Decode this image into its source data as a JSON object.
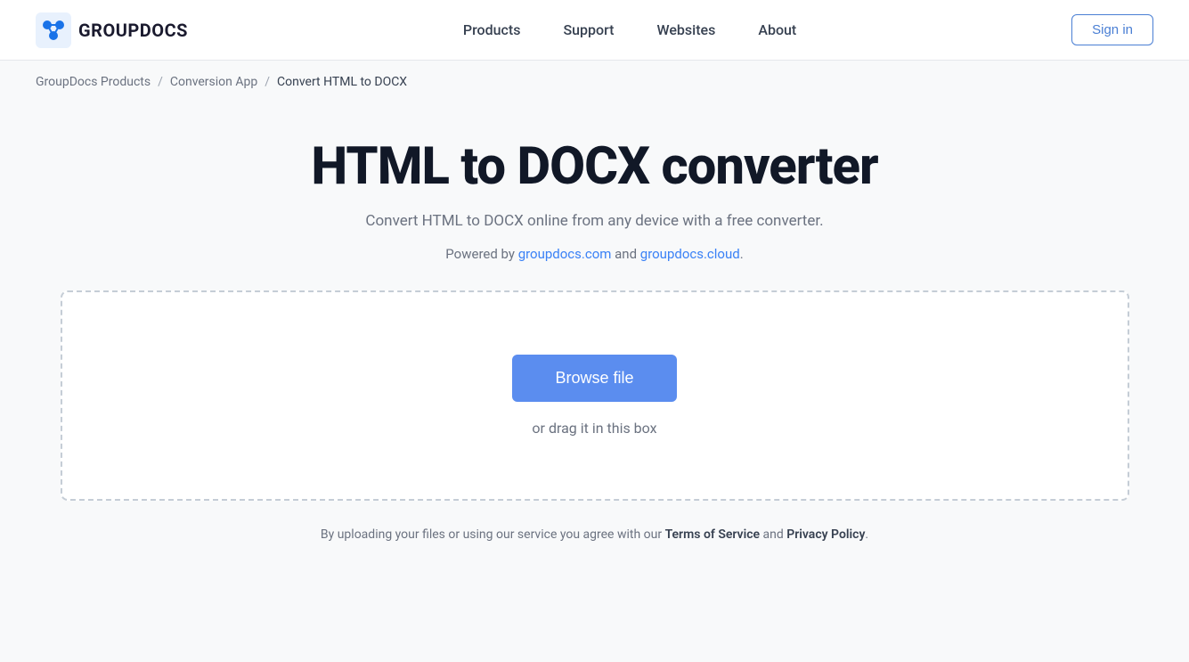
{
  "header": {
    "logo_text": "GROUPDOCS",
    "nav": {
      "products": "Products",
      "support": "Support",
      "websites": "Websites",
      "about": "About"
    },
    "sign_in": "Sign in"
  },
  "breadcrumb": {
    "root": "GroupDocs Products",
    "app": "Conversion App",
    "current": "Convert HTML to DOCX"
  },
  "main": {
    "title": "HTML to DOCX converter",
    "subtitle": "Convert HTML to DOCX online from any device with a free converter.",
    "powered_by_prefix": "Powered by ",
    "powered_by_link1": "groupdocs.com",
    "powered_by_and": " and ",
    "powered_by_link2": "groupdocs.cloud",
    "powered_by_suffix": ".",
    "browse_button": "Browse file",
    "drag_text": "or drag it in this box"
  },
  "footer": {
    "note_prefix": "By uploading your files or using our service you agree with our ",
    "terms_link": "Terms of Service",
    "note_and": " and ",
    "privacy_link": "Privacy Policy",
    "note_suffix": "."
  },
  "colors": {
    "accent_blue": "#5b8def",
    "link_blue": "#3b82f6"
  }
}
